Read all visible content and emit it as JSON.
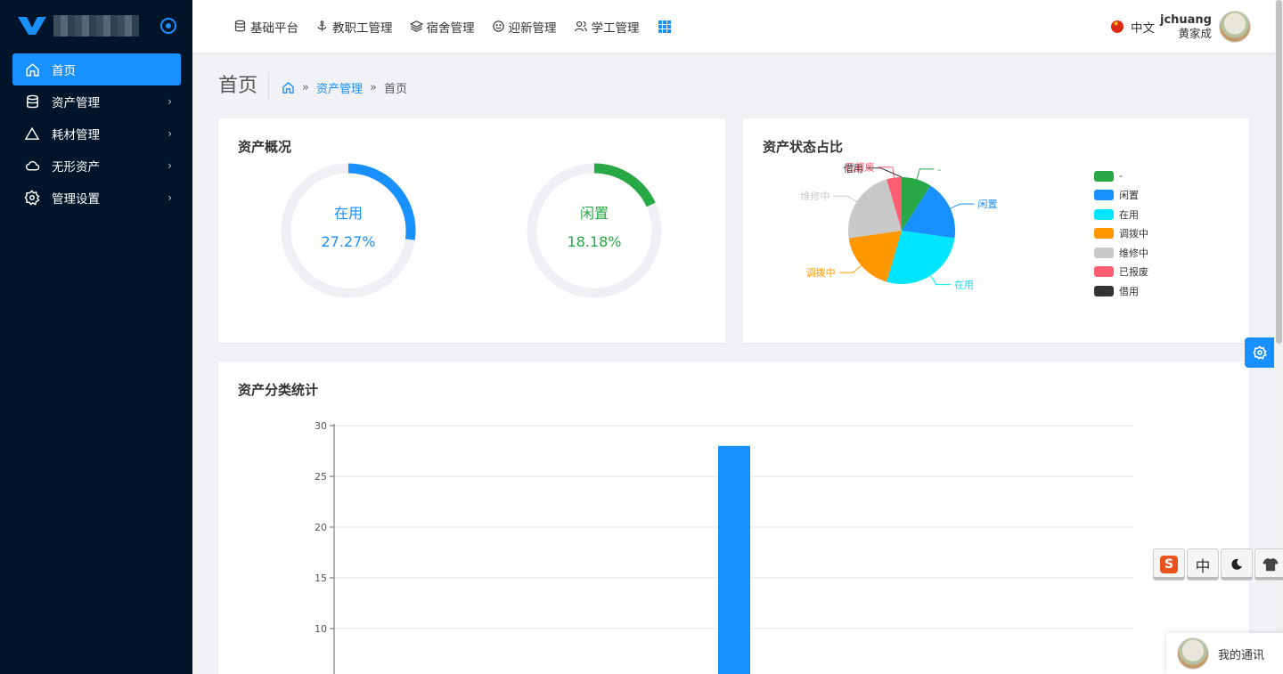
{
  "colors": {
    "accent": "#1890ff",
    "sidebar_bg": "#001529",
    "green": "#28a745"
  },
  "sidebar": {
    "items": [
      {
        "label": "首页",
        "icon": "home-icon",
        "active": true
      },
      {
        "label": "资产管理",
        "icon": "database-icon"
      },
      {
        "label": "耗材管理",
        "icon": "triangle-icon"
      },
      {
        "label": "无形资产",
        "icon": "cloud-icon"
      },
      {
        "label": "管理设置",
        "icon": "gear-icon"
      }
    ]
  },
  "topnav": {
    "items": [
      {
        "label": "基础平台",
        "icon": "database-icon"
      },
      {
        "label": "教职工管理",
        "icon": "anchor-icon"
      },
      {
        "label": "宿舍管理",
        "icon": "layers-icon"
      },
      {
        "label": "迎新管理",
        "icon": "smile-icon"
      },
      {
        "label": "学工管理",
        "icon": "users-icon"
      }
    ],
    "apps_icon": "grid-icon"
  },
  "user": {
    "lang": "中文",
    "username": "jchuang",
    "real_name": "黄家成"
  },
  "page": {
    "title": "首页",
    "breadcrumb": {
      "link": "资产管理",
      "current": "首页",
      "separator": "»"
    }
  },
  "overview": {
    "title": "资产概况",
    "rings": [
      {
        "label": "在用",
        "value_text": "27.27%",
        "fraction": 0.2727,
        "color": "#1890ff"
      },
      {
        "label": "闲置",
        "value_text": "18.18%",
        "fraction": 0.1818,
        "color": "#28a745"
      }
    ]
  },
  "status_chart": {
    "title": "资产状态占比",
    "chart_data": {
      "type": "pie",
      "slices": [
        {
          "name": "-",
          "value": 2,
          "color": "#28a745"
        },
        {
          "name": "闲置",
          "value": 4,
          "color": "#1890ff"
        },
        {
          "name": "在用",
          "value": 6,
          "color": "#00e5ff"
        },
        {
          "name": "调拨中",
          "value": 4,
          "color": "#ff9800"
        },
        {
          "name": "维修中",
          "value": 5,
          "color": "#c8c8c8"
        },
        {
          "name": "已报废",
          "value": 1,
          "color": "#ff5e72"
        },
        {
          "name": "借用",
          "value": 0,
          "color": "#333333"
        }
      ],
      "legend_position": "right"
    }
  },
  "category_chart": {
    "title": "资产分类统计",
    "chart_data": {
      "type": "bar",
      "categories": [
        "",
        "",
        "",
        "",
        ""
      ],
      "values": [
        0,
        0,
        28,
        0,
        0
      ],
      "yticks": [
        30,
        25,
        20,
        15,
        10
      ],
      "ylim": [
        0,
        30
      ],
      "bar_color": "#1890ff",
      "grid": true
    }
  },
  "floating": {
    "chat_label": "我的通讯",
    "tool_zh": "中"
  }
}
